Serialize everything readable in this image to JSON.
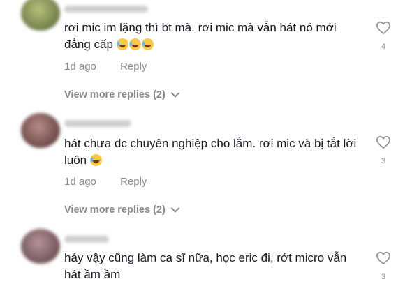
{
  "comments": [
    {
      "text": "rơi mic im lặng thì bt mà. rơi mic mà vẫn hát nó mới đẳng cấp",
      "emoji_count": 3,
      "emoji": "laughing-tears-emoji",
      "time": "1d ago",
      "reply_label": "Reply",
      "likes": "4",
      "view_more": "View more replies (2)",
      "avatar_color": "#8a9a5e"
    },
    {
      "text": "hát chưa dc chuyên nghiệp cho lắm. rơi mic và bị tắt lời luôn",
      "emoji_count": 1,
      "emoji": "sweat-smile-emoji",
      "time": "1d ago",
      "reply_label": "Reply",
      "likes": "3",
      "view_more": "View more replies (2)",
      "avatar_color": "#7a5a5a"
    },
    {
      "text": "háy vậy cũng làm ca sĩ nữa, học eric đi, rớt micro vẫn hát ầm ầm",
      "emoji_count": 0,
      "time": "",
      "reply_label": "",
      "likes": "3",
      "view_more": "",
      "avatar_color": "#8a6a6e"
    }
  ],
  "icons": {
    "heart": "heart-outline-icon",
    "chevron": "chevron-down-icon"
  },
  "colors": {
    "text": "#161823",
    "muted": "#8a8b91"
  }
}
